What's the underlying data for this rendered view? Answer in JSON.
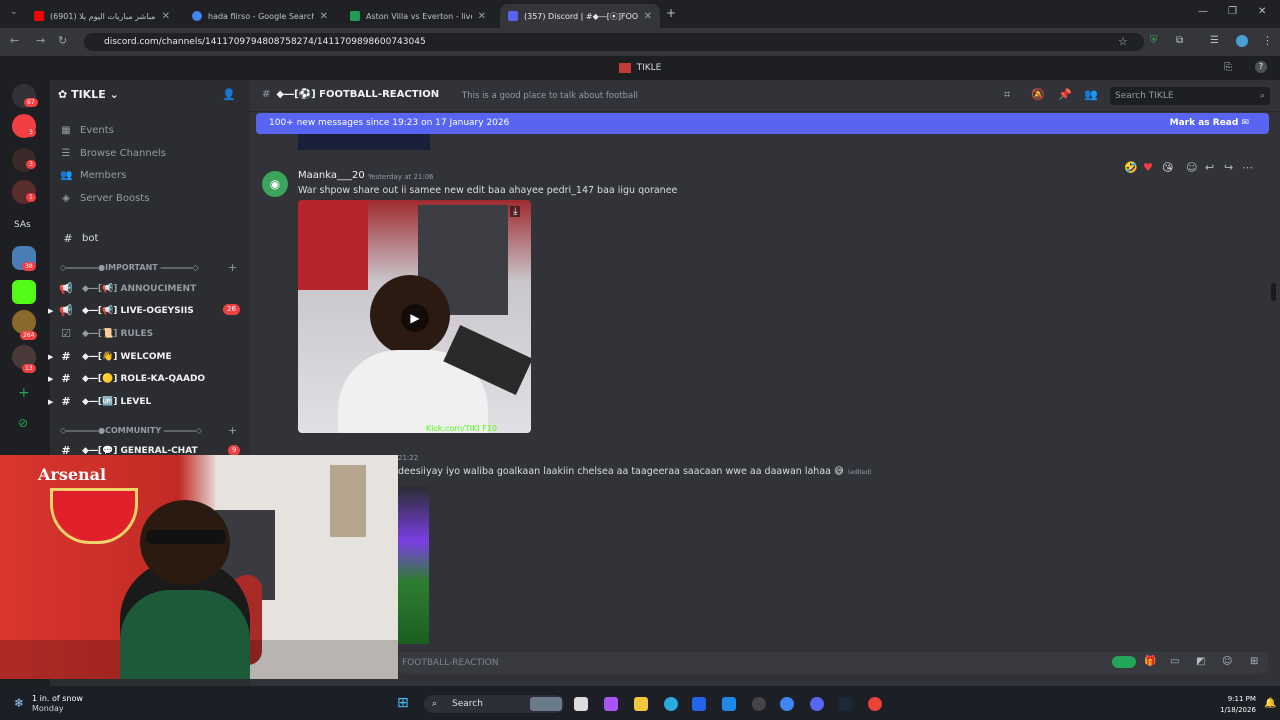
{
  "browser": {
    "tabs": [
      {
        "title": "(6901) بث مباشر مباريات اليوم يلا",
        "active": false
      },
      {
        "title": "hada fiirso - Google Search",
        "active": false
      },
      {
        "title": "Aston Villa vs Everton - live sco",
        "active": false
      },
      {
        "title": "(357) Discord | #◆―[⦿]FOOT",
        "active": true
      }
    ],
    "url": "discord.com/channels/1411709794808758274/1411709898600743045"
  },
  "discord": {
    "window_title": "TIKLE",
    "server_name": "TIKLE",
    "server_badges": [
      "67",
      "3",
      "3",
      "1",
      "38",
      "264",
      "13"
    ],
    "rail_label": "SAs",
    "sidebar_links": [
      {
        "label": "Events",
        "icon": "calendar-icon"
      },
      {
        "label": "Browse Channels",
        "icon": "list-icon"
      },
      {
        "label": "Members",
        "icon": "members-icon"
      },
      {
        "label": "Server Boosts",
        "icon": "boost-icon"
      }
    ],
    "bot_channel": "bot",
    "categories": {
      "important": "◇――――●IMPORTANT ――――◇",
      "community": "◇――――●COMMUNITY ――――◇"
    },
    "channels": [
      {
        "name": "◆―[📢] ANNOUCIMENT",
        "badge": ""
      },
      {
        "name": "◆―[📢] LIVE-OGEYSIIS",
        "badge": "26"
      },
      {
        "name": "◆―[📜] RULES",
        "badge": ""
      },
      {
        "name": "◆―[👋] WELCOME",
        "badge": ""
      },
      {
        "name": "◆―[🟡] ROLE-KA-QAADO",
        "badge": ""
      },
      {
        "name": "◆―[🆙] LEVEL",
        "badge": ""
      },
      {
        "name": "◆―[💬] GENERAL-CHAT",
        "badge": "9"
      }
    ],
    "channel_header": {
      "name": "◆―[⚽] FOOTBALL-REACTION",
      "topic": "This is a good place to talk about football",
      "search_placeholder": "Search TIKLE"
    },
    "banner": {
      "text": "100+ new messages since 19:23 on 17 January 2026",
      "action": "Mark as Read"
    },
    "messages": [
      {
        "author": "Maanka___20",
        "timestamp": "Yesterday at 21:06",
        "text": "War shpow share out ii samee new edit baa ahayee pedri_147 baa iigu qoranee",
        "video_url_text": "Kick.com/TIKI F10"
      },
      {
        "timestamp": "21:22",
        "text": "deesiiyay iyo waliba goalkaan laakiin chelsea aa taageeraa saacaan wwe aa daawan lahaa 😅",
        "edited": "(edited)"
      }
    ],
    "input_placeholder": "FOOTBALL-REACTION",
    "webcam_sign": "Arsenal"
  },
  "taskbar": {
    "weather_temp": "1 in. of snow",
    "weather_day": "Monday",
    "search": "Search",
    "time": "9:11 PM",
    "date": "1/18/2026"
  }
}
